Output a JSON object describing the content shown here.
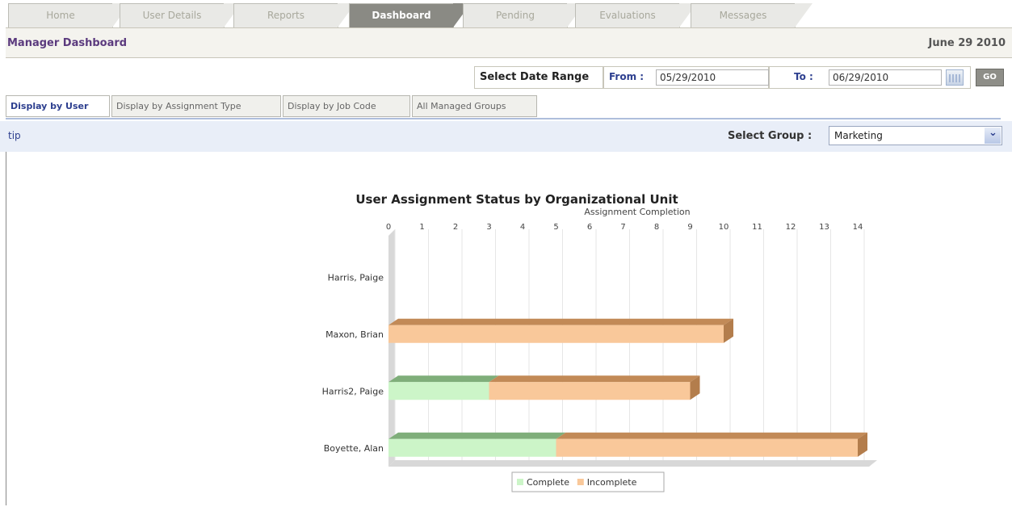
{
  "tabs": [
    {
      "label": "Home",
      "active": false
    },
    {
      "label": "User Details",
      "active": false
    },
    {
      "label": "Reports",
      "active": false
    },
    {
      "label": "Dashboard",
      "active": true
    },
    {
      "label": "Pending",
      "active": false
    },
    {
      "label": "Evaluations",
      "active": false
    },
    {
      "label": "Messages",
      "active": false
    }
  ],
  "header": {
    "title": "Manager Dashboard",
    "date": "June 29 2010"
  },
  "date_range": {
    "label": "Select Date Range",
    "from_label": "From :",
    "from_value": "05/29/2010",
    "to_label": "To :",
    "to_value": "06/29/2010",
    "go_label": "GO"
  },
  "subtabs": [
    {
      "label": "Display by User",
      "active": true
    },
    {
      "label": "Display by Assignment Type",
      "active": false
    },
    {
      "label": "Display by Job Code",
      "active": false
    },
    {
      "label": "All Managed Groups",
      "active": false
    }
  ],
  "tip_label": "tip",
  "group": {
    "label": "Select Group :",
    "value": "Marketing"
  },
  "colors": {
    "complete": "#ccf5c8",
    "incomplete": "#f9c89a",
    "accent": "#2d3f8f",
    "title": "#5b3a7e"
  },
  "chart_data": {
    "type": "bar",
    "orientation": "horizontal",
    "stacked": true,
    "title": "User Assignment Status by Organizational Unit",
    "xlabel": "Assignment Completion",
    "ylabel": "",
    "xlim": [
      0,
      14
    ],
    "x_ticks": [
      "0",
      "1",
      "2",
      "3",
      "4",
      "5",
      "6",
      "7",
      "8",
      "9",
      "10",
      "11",
      "12",
      "13",
      "14"
    ],
    "categories": [
      "Harris, Paige",
      "Maxon, Brian",
      "Harris2, Paige",
      "Boyette, Alan"
    ],
    "series": [
      {
        "name": "Complete",
        "values": [
          0,
          0,
          3,
          5
        ]
      },
      {
        "name": "Incomplete",
        "values": [
          0,
          10,
          6,
          9
        ]
      }
    ],
    "grid": true,
    "legend": "bottom"
  }
}
